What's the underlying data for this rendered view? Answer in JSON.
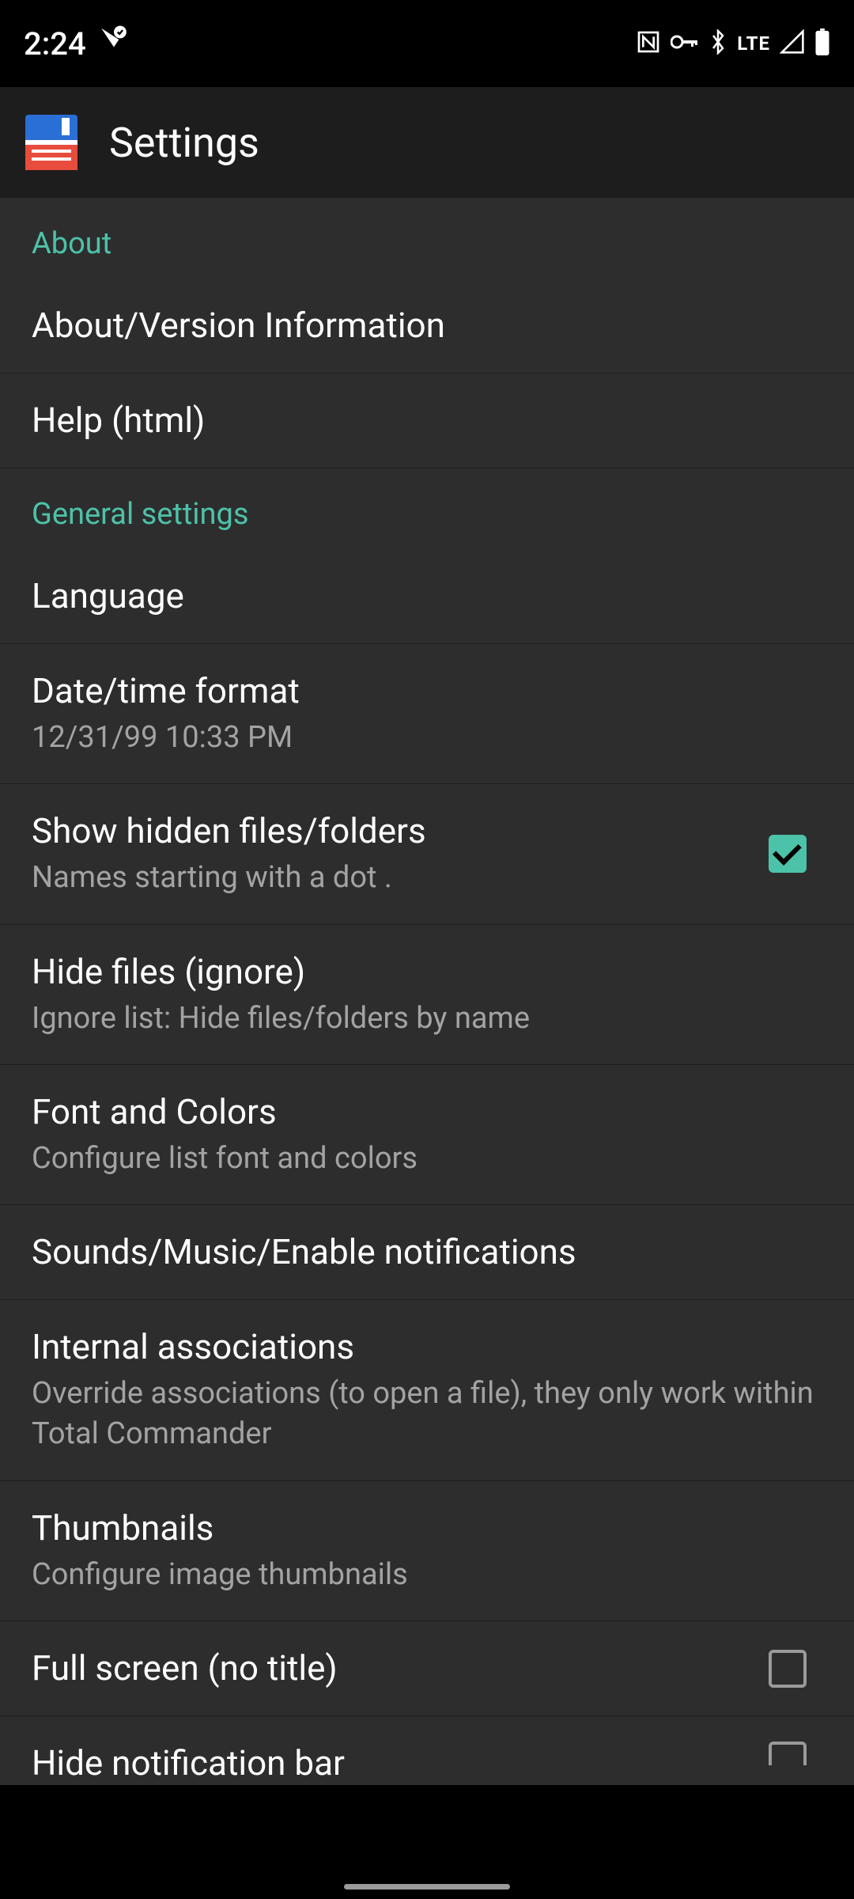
{
  "status": {
    "time": "2:24",
    "network": "LTE"
  },
  "header": {
    "title": "Settings"
  },
  "sections": {
    "about": {
      "header": "About",
      "items": [
        {
          "title": "About/Version Information"
        },
        {
          "title": "Help (html)"
        }
      ]
    },
    "general": {
      "header": "General settings",
      "items": [
        {
          "title": "Language"
        },
        {
          "title": "Date/time format",
          "subtitle": "12/31/99  10:33 PM"
        },
        {
          "title": "Show hidden files/folders",
          "subtitle": "Names starting with a dot .",
          "checked": true
        },
        {
          "title": "Hide files (ignore)",
          "subtitle": "Ignore list: Hide files/folders by name"
        },
        {
          "title": "Font and Colors",
          "subtitle": "Configure list font and colors"
        },
        {
          "title": "Sounds/Music/Enable notifications"
        },
        {
          "title": "Internal associations",
          "subtitle": "Override associations (to open a file), they only work within Total Commander"
        },
        {
          "title": "Thumbnails",
          "subtitle": "Configure image thumbnails"
        },
        {
          "title": "Full screen (no title)",
          "checked": false
        },
        {
          "title": "Hide notification bar",
          "checked": false
        }
      ]
    }
  }
}
